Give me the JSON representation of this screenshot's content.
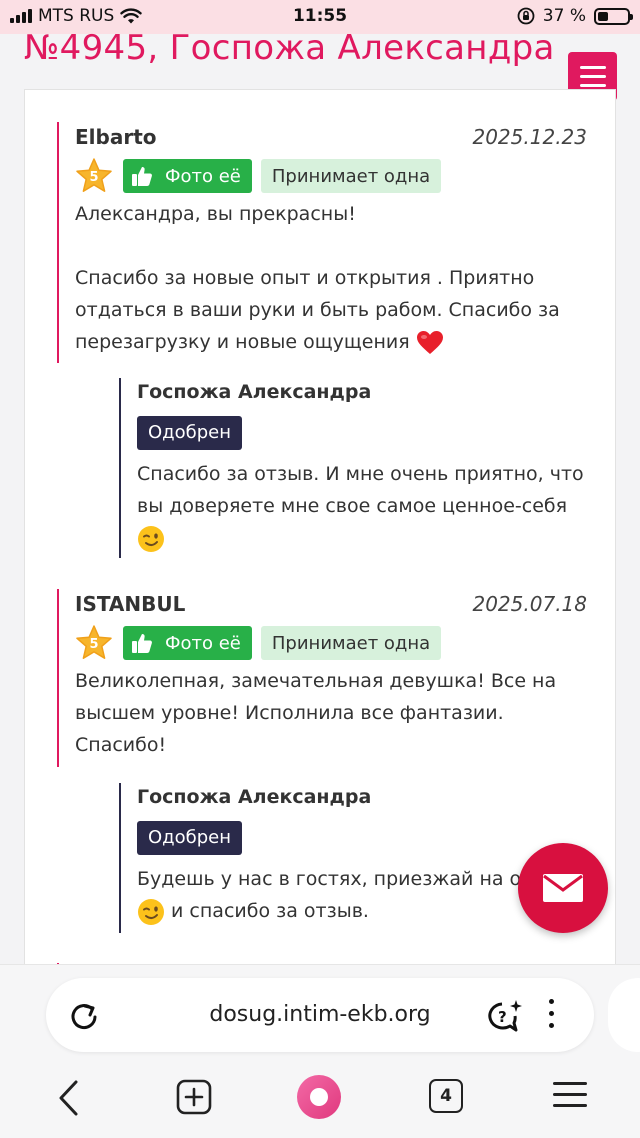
{
  "status_bar": {
    "carrier": "MTS RUS",
    "time": "11:55",
    "battery": "37 %",
    "battery_level": 0.37
  },
  "header": {
    "title": "№4945, Госпожа Александра",
    "menu_icon": "hamburger-icon"
  },
  "reviews": [
    {
      "author": "Elbarto",
      "date": "2025.12.23",
      "rating": "5",
      "photo_label": "Фото её",
      "tag": "Принимает одна",
      "text_lines": [
        "Александра, вы прекрасны!",
        "Спасибо за новые опыт и открытия . Приятно отдаться в ваши руки и быть рабом. Спасибо за перезагрузку и новые ощущения"
      ],
      "emoji": "heart",
      "reply": {
        "author": "Госпожа Александра",
        "status": "Одобрен",
        "text": "Спасибо за отзыв. И мне очень приятно, что вы доверяете мне свое самое ценное-себя",
        "emoji": "wink"
      }
    },
    {
      "author": "ISTANBUL",
      "date": "2025.07.18",
      "rating": "5",
      "photo_label": "Фото её",
      "tag": "Принимает одна",
      "text_lines": [
        "Великолепная, замечательная девушка! Все на высшем уровне! Исполнила все фантазии. Спасибо!"
      ],
      "reply": {
        "author": "Госпожа Александра",
        "status": "Одобрен",
        "text_line1": "Будешь у нас в гостях, приезжай на ог",
        "text_line2": "и спасибо за отзыв.",
        "emoji": "wink"
      }
    }
  ],
  "browser": {
    "url": "dosug.intim-ekb.org",
    "tab_count": "4"
  },
  "colors": {
    "brand": "#e0195f",
    "approved_bg": "#2a2a4a",
    "photo_green": "#28b048",
    "tag_green": "#d7f1dc",
    "mail_red": "#d8103f"
  }
}
